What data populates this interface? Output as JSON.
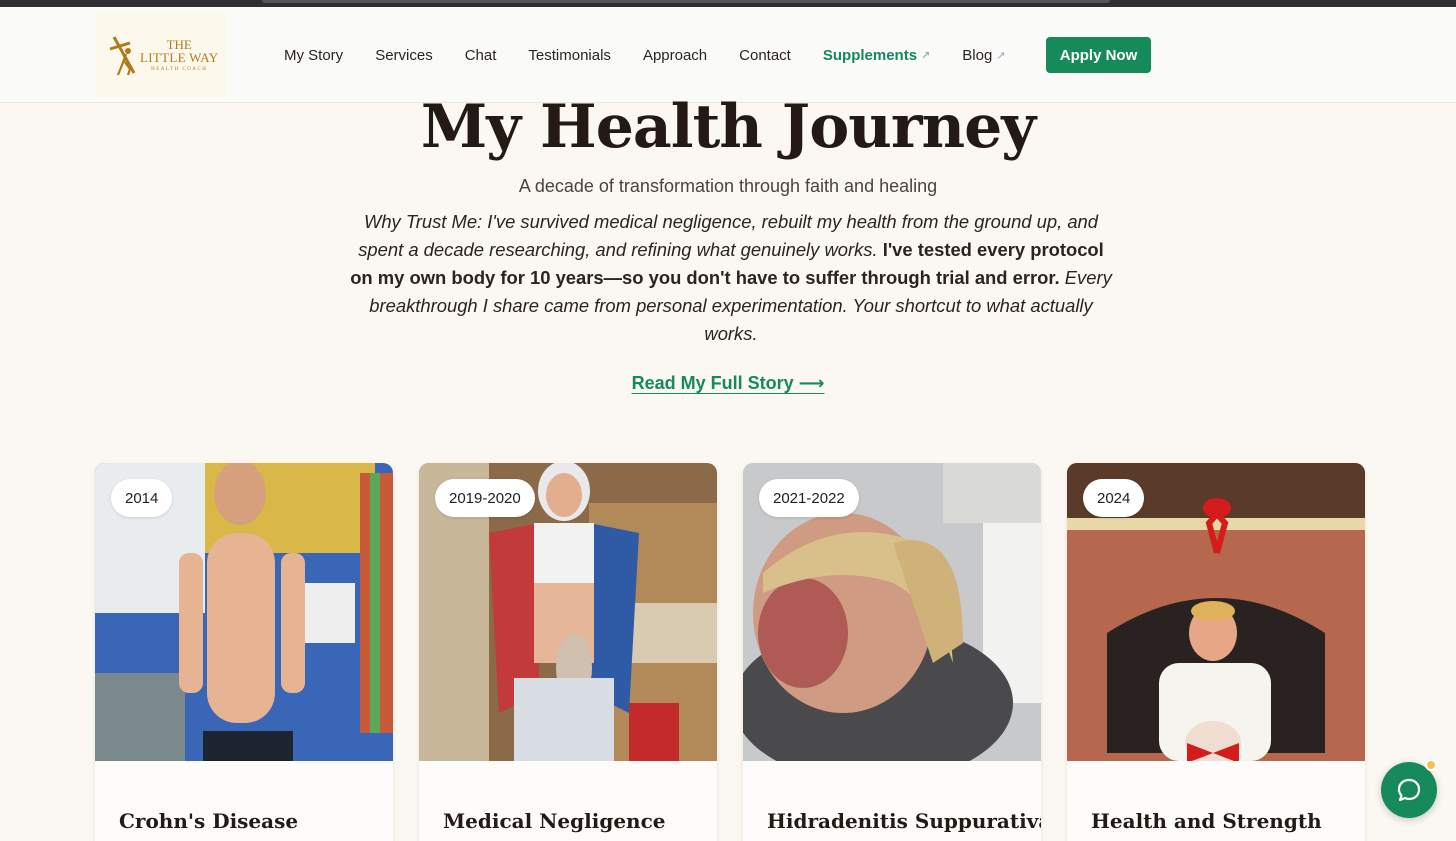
{
  "nav": {
    "logo": {
      "line1": "THE",
      "line2": "LITTLE WAY",
      "line3": "HEALTH COACH"
    },
    "items": [
      {
        "label": "My Story",
        "external": false
      },
      {
        "label": "Services",
        "external": false
      },
      {
        "label": "Chat",
        "external": false
      },
      {
        "label": "Testimonials",
        "external": false
      },
      {
        "label": "Approach",
        "external": false
      },
      {
        "label": "Contact",
        "external": false
      },
      {
        "label": "Supplements",
        "external": true,
        "highlight": true
      },
      {
        "label": "Blog",
        "external": true
      }
    ],
    "cta": "Apply Now",
    "external_glyph": "↗"
  },
  "hero": {
    "title": "My Health Journey",
    "subtitle": "A decade of transformation through faith and healing",
    "trust_italic_1": "Why Trust Me: I've survived medical negligence, rebuilt my health from the ground up, and spent a decade researching, and refining what genuinely works.",
    "trust_bold": " I've tested every protocol on my own body for 10 years—so you don't have to suffer through trial and error.",
    "trust_italic_2": " Every breakthrough I share came from personal experimentation. Your shortcut to what actually works.",
    "read_more": "Read My Full Story ⟶"
  },
  "timeline": [
    {
      "year": "2014",
      "title": "Crohn's Disease"
    },
    {
      "year": "2019-2020",
      "title": "Medical Negligence"
    },
    {
      "year": "2021-2022",
      "title": "Hidradenitis Suppurativa"
    },
    {
      "year": "2024",
      "title": "Health and Strength"
    }
  ],
  "colors": {
    "accent": "#168a5a",
    "background": "#fbf7f2",
    "gold": "#b07a1d"
  },
  "icons": {
    "chat": "chat-bubble-icon",
    "logo": "cross-figure-icon"
  }
}
